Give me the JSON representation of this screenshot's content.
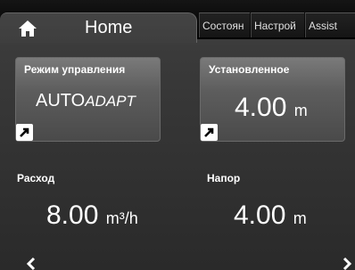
{
  "tabs": {
    "home": {
      "label": "Home",
      "icon": "home-icon"
    },
    "status": {
      "label": "Состоян"
    },
    "settings": {
      "label": "Настрой"
    },
    "assist": {
      "label": "Assist"
    }
  },
  "tiles": {
    "control_mode": {
      "title": "Режим управления",
      "value_main": "AUTO",
      "value_italic": "ADAPT",
      "icon": "arrow-link-icon"
    },
    "setpoint": {
      "title": "Установленное",
      "value": "4.00",
      "unit": "m",
      "icon": "arrow-link-icon"
    }
  },
  "readings": {
    "flow": {
      "label": "Расход",
      "value": "8.00",
      "unit": "m³/h"
    },
    "head": {
      "label": "Напор",
      "value": "4.00",
      "unit": "m"
    }
  },
  "nav": {
    "prev_icon": "chevron-left-icon",
    "next_icon": "chevron-right-icon"
  },
  "colors": {
    "background": "#3a3a3a",
    "tab_bar": "#000000",
    "text": "#ffffff"
  }
}
